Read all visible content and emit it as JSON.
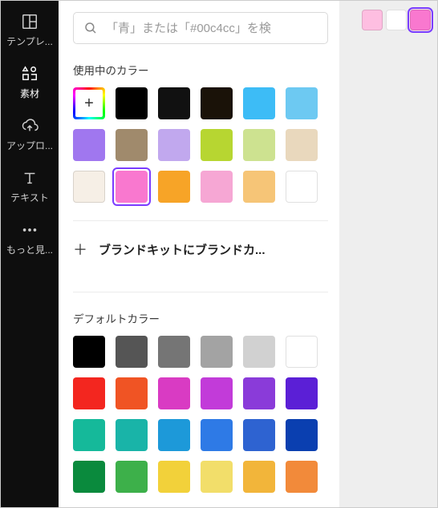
{
  "rail": [
    {
      "id": "templates",
      "label": "テンプレ..."
    },
    {
      "id": "elements",
      "label": "素材",
      "active": true
    },
    {
      "id": "uploads",
      "label": "アップロ..."
    },
    {
      "id": "text",
      "label": "テキスト"
    },
    {
      "id": "more",
      "label": "もっと見..."
    }
  ],
  "search": {
    "placeholder": "「青」または「#00c4cc」を検"
  },
  "sections": {
    "inuse_title": "使用中のカラー",
    "brand_row": "ブランドキットにブランドカ...",
    "default_title": "デフォルトカラー"
  },
  "inuse_colors": [
    "ADD",
    "#000000",
    "#111111",
    "#1a1208",
    "#3dbcf6",
    "#6dc9f2",
    "#a077ef",
    "#a08a6c",
    "#c1a8ee",
    "#b7d631",
    "#cde290",
    "#e9d8bd",
    "#f6efe6",
    "#f978cf",
    "#f7a427",
    "#f6a7d4",
    "#f6c577",
    "#ffffff"
  ],
  "inuse_selected_index": 13,
  "default_colors": [
    "#000000",
    "#555555",
    "#757575",
    "#a3a3a3",
    "#d1d1d1",
    "#ffffff",
    "#f3261f",
    "#f05424",
    "#d93bc3",
    "#c23bd9",
    "#8a3bd9",
    "#5b1fd6",
    "#15b99a",
    "#19b4a8",
    "#1d99d9",
    "#2e7ae6",
    "#2e63d1",
    "#0a3fb0",
    "#0a8a3d",
    "#3db04a",
    "#f2d13a",
    "#f2de6a",
    "#f2b53a",
    "#f28a3a"
  ],
  "topright_colors": [
    "#febee1",
    "#ffffff",
    "#f978cf"
  ],
  "topright_selected_index": 2
}
